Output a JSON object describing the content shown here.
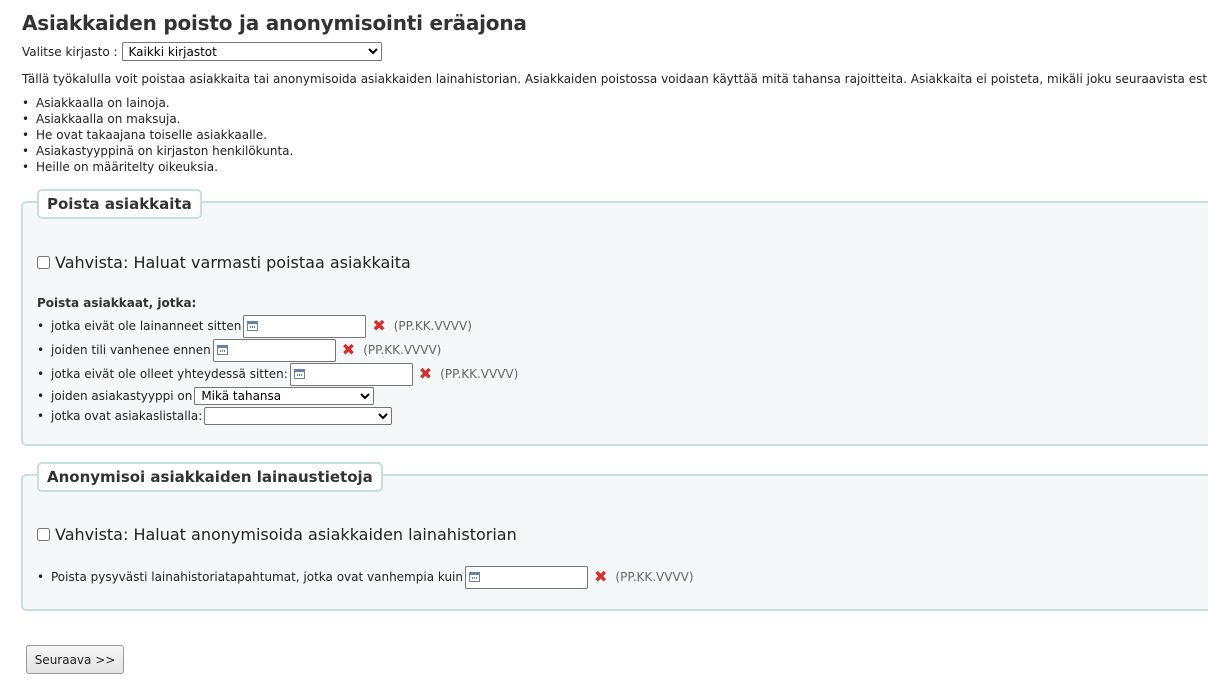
{
  "page": {
    "title": "Asiakkaiden poisto ja anonymisointi eräajona"
  },
  "library": {
    "label": "Valitse kirjasto :",
    "selected": "Kaikki kirjastot"
  },
  "intro": "Tällä työkalulla voit poistaa asiakkaita tai anonymisoida asiakkaiden lainahistorian. Asiakkaiden poistossa voidaan käyttää mitä tahansa rajoitteita. Asiakkaita ei poisteta, mikäli joku seuraavista estää sen:",
  "rules": [
    "Asiakkaalla on lainoja.",
    "Asiakkaalla on maksuja.",
    "He ovat takaajana toiselle asiakkaalle.",
    "Asiakastyyppinä on kirjaston henkilökunta.",
    "Heille on määritelty oikeuksia."
  ],
  "delete": {
    "legend": "Poista asiakkaita",
    "confirm_label": "Vahvista: Haluat varmasti poistaa asiakkaita",
    "subheading": "Poista asiakkaat, jotka:",
    "criteria": {
      "not_borrowed_since": "jotka eivät ole lainanneet sitten",
      "expires_before": "joiden tili vanhenee ennen",
      "last_seen": "jotka eivät ole olleet yhteydessä sitten:",
      "category": "joiden asiakastyyppi on",
      "category_selected": "Mikä tahansa",
      "patron_list": "jotka ovat asiakaslistalla:",
      "patron_list_selected": ""
    },
    "date_format": "(PP.KK.VVVV)"
  },
  "anonymize": {
    "legend": "Anonymisoi asiakkaiden lainaustietoja",
    "confirm_label": "Vahvista: Haluat anonymisoida asiakkaiden lainahistorian",
    "older_than": "Poista pysyvästi lainahistoriatapahtumat, jotka ovat vanhempia kuin",
    "date_format": "(PP.KK.VVVV)"
  },
  "next_button": "Seuraava >>",
  "colors": {
    "fieldset_border": "#c7dfe3",
    "fieldset_bg": "#f4f8f9",
    "clear_x": "#d32f2f"
  },
  "icons": {
    "date": "calendar-icon",
    "clear": "clear-x-icon"
  }
}
